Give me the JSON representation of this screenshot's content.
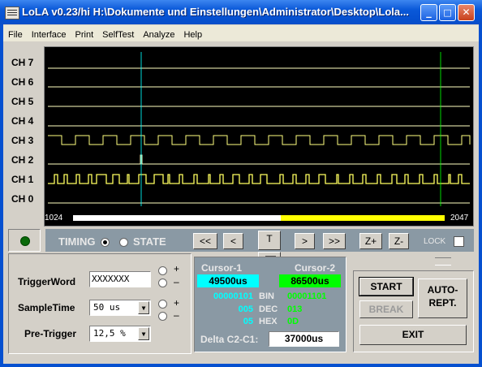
{
  "window": {
    "title": "LoLA v0.23/hi  H:\\Dokumente und Einstellungen\\Administrator\\Desktop\\Lola...",
    "minimize": "_",
    "maximize": "□",
    "close": "✕"
  },
  "menu": [
    "File",
    "Interface",
    "Print",
    "SelfTest",
    "Analyze",
    "Help"
  ],
  "channels": [
    "CH 7",
    "CH 6",
    "CH 5",
    "CH 4",
    "CH 3",
    "CH 2",
    "CH 1",
    "CH 0"
  ],
  "scope": {
    "range_start": "1024",
    "range_end": "2047",
    "scroll_window": [
      0.56,
      1.0
    ]
  },
  "controls": {
    "timing_label": "TIMING",
    "state_label": "STATE",
    "mode_selected": "TIMING",
    "nav": [
      "<<",
      "<",
      "T",
      ">",
      ">>",
      "Z+",
      "Z-"
    ],
    "lock_label": "LOCK"
  },
  "trigger": {
    "word_label": "TriggerWord",
    "word_value": "XXXXXXX",
    "sampletime_label": "SampleTime",
    "sampletime_value": "50 us",
    "pretrigger_label": "Pre-Trigger",
    "pretrigger_value": "12,5 %",
    "plus": "+",
    "minus": "–"
  },
  "cursors": {
    "c1_label": "Cursor-1",
    "c2_label": "Cursor-2",
    "c1_value": "49500us",
    "c2_value": "86500us",
    "c1_bin": "00000101",
    "c2_bin": "00001101",
    "bin_label": "BIN",
    "c1_dec": "005",
    "c2_dec": "013",
    "dec_label": "DEC",
    "c1_hex": "05",
    "c2_hex": "0D",
    "hex_label": "HEX",
    "delta_label": "Delta C2-C1:",
    "delta_value": "37000us",
    "c1_color": "#00ffff",
    "c2_color": "#00ff00"
  },
  "actions": {
    "start": "START",
    "break": "BREAK",
    "auto_line1": "AUTO-",
    "auto_line2": "REPT.",
    "exit": "EXIT"
  }
}
